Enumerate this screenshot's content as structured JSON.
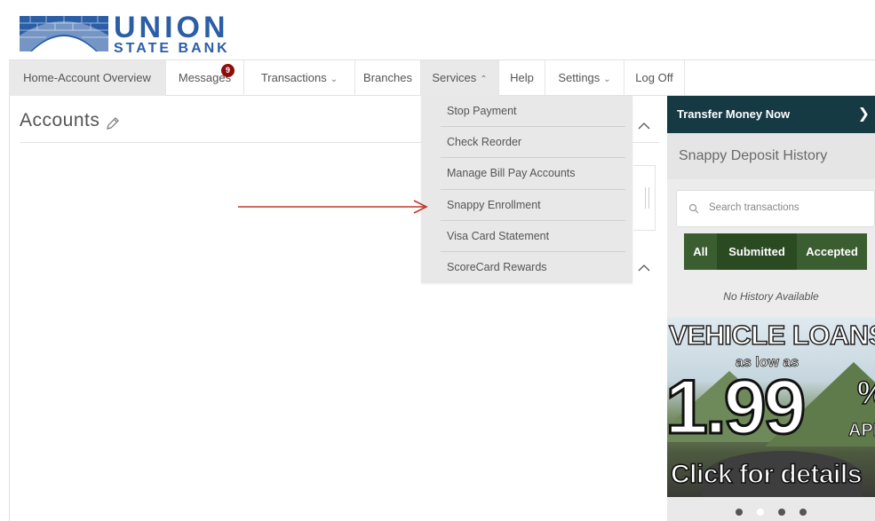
{
  "brand": {
    "name_line1": "UNION",
    "name_line2": "STATE BANK",
    "primary_color": "#163a43",
    "logo_blue": "#2b5ea7"
  },
  "nav": {
    "items": [
      {
        "label": "Home-Account Overview"
      },
      {
        "label": "Messages",
        "badge": "9"
      },
      {
        "label": "Transactions",
        "icon": "chevron-down-icon"
      },
      {
        "label": "Branches"
      },
      {
        "label": "Services",
        "icon": "chevron-up-icon",
        "expanded": true
      },
      {
        "label": "Help"
      },
      {
        "label": "Settings",
        "icon": "chevron-down-icon"
      },
      {
        "label": "Log Off"
      }
    ]
  },
  "services_menu": {
    "items": [
      {
        "label": "Stop Payment"
      },
      {
        "label": "Check Reorder"
      },
      {
        "label": "Manage Bill Pay Accounts"
      },
      {
        "label": "Snappy Enrollment",
        "highlighted_by_arrow": true
      },
      {
        "label": "Visa Card Statement"
      },
      {
        "label": "ScoreCard Rewards"
      }
    ]
  },
  "accounts": {
    "title": "Accounts",
    "edit_icon": "pencil-icon"
  },
  "sidebar": {
    "transfer_label": "Transfer Money Now",
    "snappy_title": "Snappy Deposit History",
    "search_placeholder": "Search transactions",
    "filters": [
      {
        "label": "All"
      },
      {
        "label": "Submitted"
      },
      {
        "label": "Accepted"
      }
    ],
    "filter_color": "#2a4a22",
    "empty_text": "No History Available"
  },
  "ad": {
    "headline": "VEHICLE LOANS",
    "sub": "as low as",
    "rate": "1.99",
    "pct": "%",
    "apr": "APR",
    "cta": "Click for details",
    "carousel_count": 4,
    "active_slide": 2
  },
  "annotation": {
    "arrow_color": "#c0392b"
  }
}
